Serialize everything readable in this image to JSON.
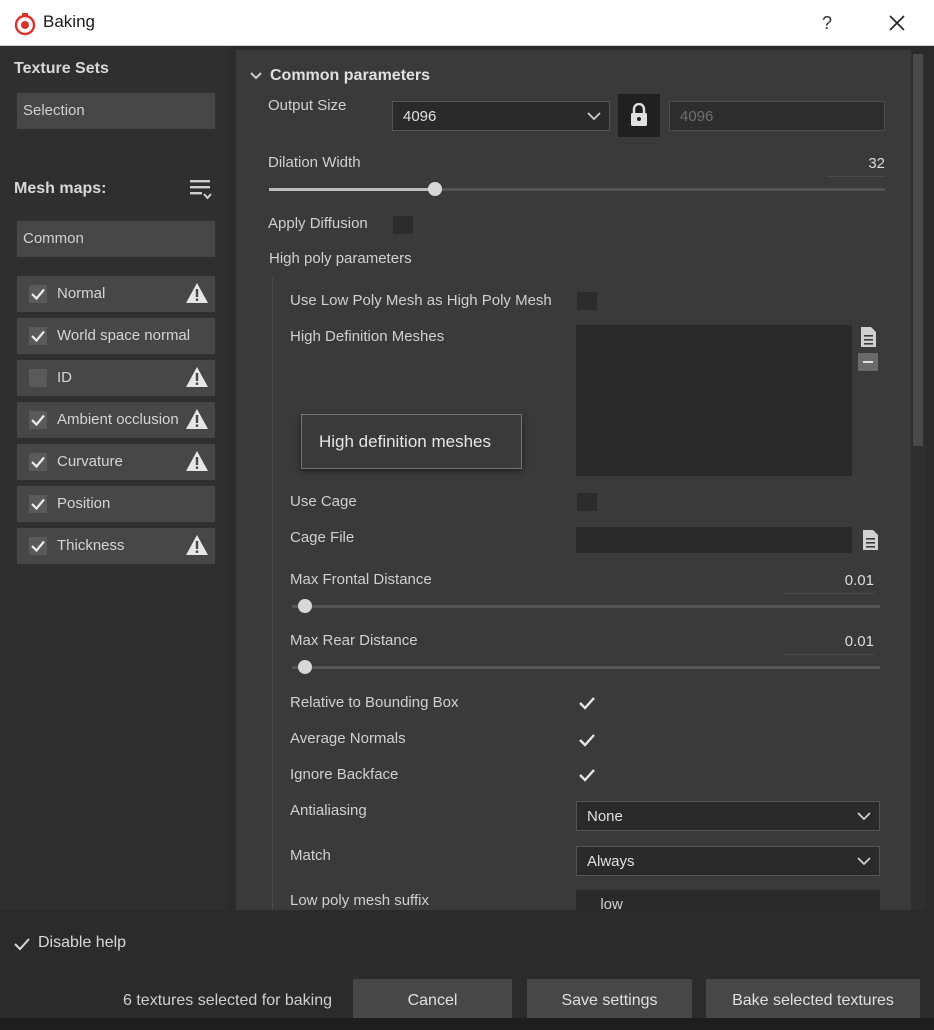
{
  "window": {
    "title": "Baking",
    "help_label": "?"
  },
  "left": {
    "texture_sets_heading": "Texture Sets",
    "texture_set_value": "Selection",
    "mesh_maps_heading": "Mesh maps:",
    "mesh_map_filter_value": "Common",
    "maps": [
      {
        "label": "Normal",
        "checked": true,
        "warning": true
      },
      {
        "label": "World space normal",
        "checked": true,
        "warning": false
      },
      {
        "label": "ID",
        "checked": false,
        "warning": true
      },
      {
        "label": "Ambient occlusion",
        "checked": true,
        "warning": true
      },
      {
        "label": "Curvature",
        "checked": true,
        "warning": true
      },
      {
        "label": "Position",
        "checked": true,
        "warning": false
      },
      {
        "label": "Thickness",
        "checked": true,
        "warning": true
      }
    ]
  },
  "main": {
    "group_title": "Common parameters",
    "output_size_label": "Output Size",
    "output_size_value": "4096",
    "output_size_locked_value": "4096",
    "dilation_label": "Dilation Width",
    "dilation_value": "32",
    "dilation_fraction": 0.27,
    "apply_diffusion_label": "Apply Diffusion",
    "high_poly_label": "High poly parameters",
    "use_low_as_high_label": "Use Low Poly Mesh as High Poly Mesh",
    "hd_meshes_label": "High Definition Meshes",
    "use_cage_label": "Use Cage",
    "cage_file_label": "Cage File",
    "max_frontal_label": "Max Frontal Distance",
    "max_frontal_value": "0.01",
    "max_rear_label": "Max Rear Distance",
    "max_rear_value": "0.01",
    "relative_bbox_label": "Relative to Bounding Box",
    "average_normals_label": "Average Normals",
    "ignore_backface_label": "Ignore Backface",
    "antialiasing_label": "Antialiasing",
    "antialiasing_value": "None",
    "match_label": "Match",
    "match_value": "Always",
    "low_suffix_label": "Low poly mesh suffix",
    "low_suffix_value": "_low"
  },
  "tooltip": {
    "text": "High definition meshes"
  },
  "footer": {
    "disable_help_label": "Disable help",
    "status": "6 textures selected for baking",
    "cancel_label": "Cancel",
    "save_label": "Save settings",
    "bake_label": "Bake selected textures"
  },
  "colors": {
    "accent_red": "#d9332b",
    "panel": "#3a3a3a",
    "background": "#2b2b2b"
  }
}
